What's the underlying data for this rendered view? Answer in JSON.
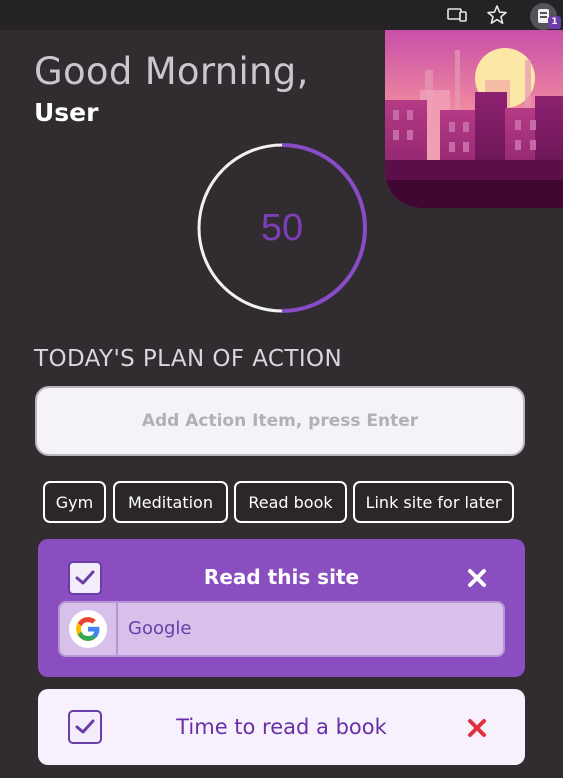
{
  "toolbar": {
    "icons": [
      "cast-icon",
      "bookmark-star-icon",
      "extension-icon"
    ],
    "extension_badge": "1"
  },
  "greeting": {
    "text": "Good Morning,",
    "user": "User"
  },
  "timer": {
    "value": "50",
    "progress": 0.5,
    "accent": "#7c3fb8"
  },
  "plan": {
    "heading": "TODAY'S PLAN OF ACTION",
    "input_placeholder": "Add Action Item, press Enter",
    "suggestions": [
      {
        "label": "Gym"
      },
      {
        "label": "Meditation"
      },
      {
        "label": "Read book"
      },
      {
        "label": "Link site for later"
      }
    ]
  },
  "tasks": [
    {
      "title": "Read this site",
      "checked": true,
      "link": {
        "name": "Google",
        "icon": "google-icon"
      },
      "color": "#8b4ec0"
    },
    {
      "title": "Time to read a book",
      "checked": true,
      "color": "#f6f1fc"
    }
  ]
}
